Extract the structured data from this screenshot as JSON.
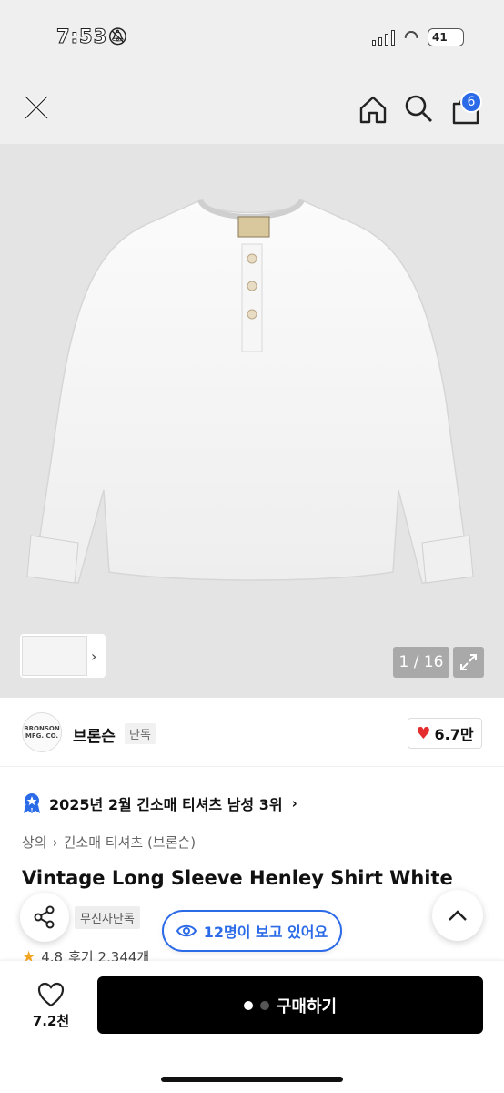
{
  "status_bar": {
    "time": "7:53",
    "battery": "41"
  },
  "header": {
    "cart_count": "6"
  },
  "gallery": {
    "page_counter": "1 / 16"
  },
  "brand": {
    "logo_text": "BRONSON MFG. CO.",
    "name": "브론슨",
    "tag": "단독",
    "likes": "6.7만"
  },
  "ranking": {
    "text": "2025년 2월 긴소매 티셔츠 남성 3위"
  },
  "breadcrumb": {
    "items": [
      "상의",
      "긴소매 티셔츠 (브론슨)"
    ]
  },
  "product": {
    "title": "Vintage Long Sleeve Henley Shirt White"
  },
  "tags": {
    "exclusive": "무신사단독"
  },
  "viewers": {
    "text": "12명이 보고 있어요"
  },
  "rating": {
    "score": "4.8",
    "reviews": "후기 2,344개"
  },
  "bottom": {
    "wish_count": "7.2천",
    "buy_label": "구매하기"
  },
  "colors": {
    "accent": "#2c6be8",
    "heart": "#e52d2d",
    "star": "#f5a623",
    "buy_bg": "#000000"
  },
  "icons": [
    "close-icon",
    "home-icon",
    "search-icon",
    "shopping-bag-icon",
    "expand-icon",
    "heart-icon",
    "ranking-badge-icon",
    "share-icon",
    "eye-icon",
    "chevron-up-icon",
    "star-icon"
  ]
}
